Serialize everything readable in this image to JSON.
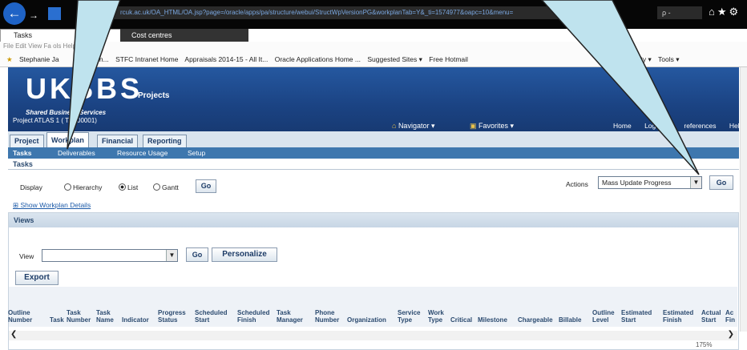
{
  "browser": {
    "address": "rcuk.ac.uk/OA_HTML/OA.jsp?page=/oracle/apps/pa/structure/webui/StructWpVersionPG&workplanTab=Y&_ti=1574977&oapc=10&menu=",
    "search_text": "ρ -",
    "tab1": "Tasks",
    "tab2": "Cost centres",
    "menubar": "File  Edit  View  Fa          ols  Help",
    "zoom": "175%"
  },
  "favorites": {
    "user": "Stephanie Ja",
    "in": "in...",
    "items": [
      "STFC Intranet Home",
      "Appraisals 2014-15 - All It...",
      "Oracle Applications Home ...",
      "Suggested Sites ▾",
      "Free Hotmail"
    ],
    "tail": [
      "e ▾",
      "Safety ▾",
      "Tools ▾"
    ]
  },
  "banner": {
    "logo": "UKSBS",
    "shared": "Shared Business Services",
    "project_id": "Project ATLAS 1 (  TAK00001)",
    "title": "Projects",
    "navigator": "Navigator ▾",
    "favorites": "Favorites ▾",
    "links": [
      "Home",
      "Logo",
      "references",
      "Help"
    ]
  },
  "tabs": [
    "Project",
    "Workplan",
    "Financial",
    "Reporting"
  ],
  "subtabs": [
    "Tasks",
    "Deliverables",
    "Resource Usage",
    "Setup"
  ],
  "tasks": {
    "heading": "Tasks",
    "display_label": "Display",
    "options": [
      "Hierarchy",
      "List",
      "Gantt"
    ],
    "go": "Go",
    "show_details": "Show Workplan Details",
    "actions_label": "Actions",
    "actions_value": "Mass Update Progress",
    "actions_go": "Go"
  },
  "views": {
    "heading": "Views",
    "view_label": "View",
    "go": "Go",
    "personalize": "Personalize",
    "export": "Export"
  },
  "columns": [
    [
      "Outline",
      "Number"
    ],
    [
      "",
      "Task"
    ],
    [
      "Task",
      "Number"
    ],
    [
      "Task",
      "Name"
    ],
    [
      "",
      "Indicator"
    ],
    [
      "Progress",
      "Status"
    ],
    [
      "Scheduled",
      "Start"
    ],
    [
      "Scheduled",
      "Finish"
    ],
    [
      "Task",
      "Manager"
    ],
    [
      "Phone",
      "Number"
    ],
    [
      "",
      "Organization"
    ],
    [
      "Service",
      "Type"
    ],
    [
      "Work",
      "Type"
    ],
    [
      "",
      "Critical"
    ],
    [
      "",
      "Milestone"
    ],
    [
      "",
      "Chargeable"
    ],
    [
      "",
      "Billable"
    ],
    [
      "Outline",
      "Level"
    ],
    [
      "Estimated",
      "Start"
    ],
    [
      "Estimated",
      "Finish"
    ],
    [
      "Actual",
      "Start"
    ],
    [
      "Ac",
      "Fin"
    ]
  ],
  "colors": {
    "banner": "#1b4383",
    "callout": "#bfe3ee"
  }
}
